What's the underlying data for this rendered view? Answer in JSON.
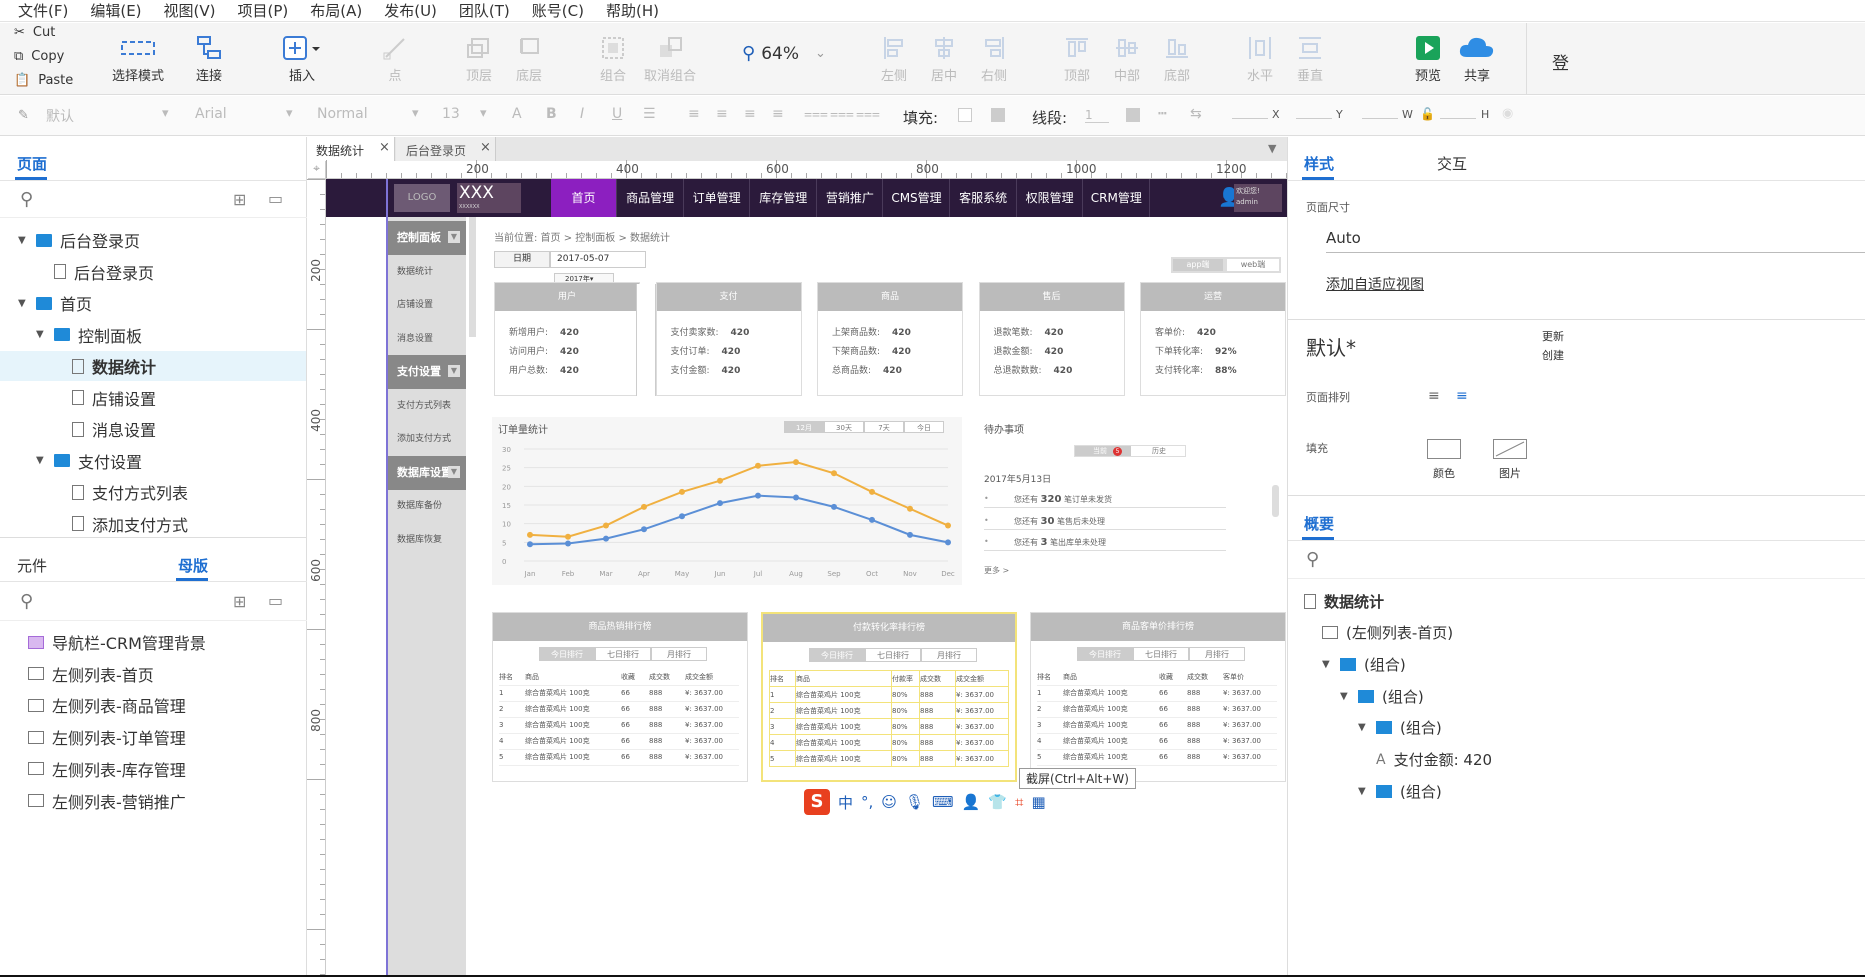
{
  "menu": [
    "文件(F)",
    "编辑(E)",
    "视图(V)",
    "项目(P)",
    "布局(A)",
    "发布(U)",
    "团队(T)",
    "账号(C)",
    "帮助(H)"
  ],
  "clipboard": {
    "cut": "Cut",
    "copy": "Copy",
    "paste": "Paste"
  },
  "toolbar": {
    "select_mode": "选择模式",
    "connect": "连接",
    "insert": "插入",
    "point": "点",
    "top_layer": "顶层",
    "bottom_layer": "底层",
    "group": "组合",
    "ungroup": "取消组合",
    "zoom": "64%",
    "align_left": "左侧",
    "align_center": "居中",
    "align_right": "右侧",
    "align_top": "顶部",
    "align_middle": "中部",
    "align_bottom": "底部",
    "dist_h": "水平",
    "dist_v": "垂直",
    "preview": "预览",
    "share": "共享",
    "login": "登"
  },
  "format": {
    "style_placeholder": "默认",
    "font": "Arial",
    "weight": "Normal",
    "size": "13",
    "fill_label": "填充:",
    "line_label": "线段:",
    "line_value": "1",
    "x": "X",
    "y": "Y",
    "w": "W",
    "h": "H"
  },
  "left": {
    "pages_tab": "页面",
    "pages": [
      {
        "label": "后台登录页",
        "level": 0,
        "type": "folder"
      },
      {
        "label": "后台登录页",
        "level": 1,
        "type": "page"
      },
      {
        "label": "首页",
        "level": 0,
        "type": "folder"
      },
      {
        "label": "控制面板",
        "level": 1,
        "type": "folder"
      },
      {
        "label": "数据统计",
        "level": 2,
        "type": "page"
      },
      {
        "label": "店铺设置",
        "level": 2,
        "type": "page"
      },
      {
        "label": "消息设置",
        "level": 2,
        "type": "page"
      },
      {
        "label": "支付设置",
        "level": 1,
        "type": "folder"
      },
      {
        "label": "支付方式列表",
        "level": 2,
        "type": "page"
      },
      {
        "label": "添加支付方式",
        "level": 2,
        "type": "page"
      }
    ],
    "widgets_tab": "元件",
    "masters_tab": "母版",
    "masters": [
      "导航栏-CRM管理背景",
      "左侧列表-首页",
      "左侧列表-商品管理",
      "左侧列表-订单管理",
      "左侧列表-库存管理",
      "左侧列表-营销推广"
    ]
  },
  "canvas": {
    "tabs": [
      "数据统计",
      "后台登录页"
    ],
    "ruler_h": [
      "200",
      "400",
      "600",
      "800",
      "1000",
      "1200"
    ],
    "ruler_v": [
      "200",
      "400",
      "600",
      "800"
    ],
    "nav": {
      "logo": "LOGO",
      "brand": "XXX",
      "brand_sub": "XXXXXX",
      "items": [
        "首页",
        "商品管理",
        "订单管理",
        "库存管理",
        "营销推广",
        "CMS管理",
        "客服系统",
        "权限管理",
        "CRM管理"
      ],
      "welcome": "欢迎您!",
      "user": "admin"
    },
    "side": [
      {
        "label": "控制面板",
        "hd": true
      },
      {
        "label": "数据统计"
      },
      {
        "label": "店铺设置"
      },
      {
        "label": "消息设置"
      },
      {
        "label": "支付设置",
        "hd": true
      },
      {
        "label": "支付方式列表"
      },
      {
        "label": "添加支付方式"
      },
      {
        "label": "数据库设置",
        "hd": true
      },
      {
        "label": "数据库备份"
      },
      {
        "label": "数据库恢复"
      }
    ],
    "breadcrumb": "当前位置:   首页  >  控制面板  >  数据统计",
    "date_label": "日期",
    "date_value": "2017-05-07",
    "date_dropdown": "2017年▾",
    "switch": [
      "app端",
      "web端"
    ],
    "cards": [
      {
        "title": "用户",
        "rows": [
          [
            "新增用户:",
            "420"
          ],
          [
            "访问用户:",
            "420"
          ],
          [
            "用户总数:",
            "420"
          ]
        ]
      },
      {
        "title": "支付",
        "rows": [
          [
            "支付卖家数:",
            "420"
          ],
          [
            "支付订单:",
            "420"
          ],
          [
            "支付金额:",
            "420"
          ]
        ]
      },
      {
        "title": "商品",
        "rows": [
          [
            "上架商品数:",
            "420"
          ],
          [
            "下架商品数:",
            "420"
          ],
          [
            "总商品数:",
            "420"
          ]
        ]
      },
      {
        "title": "售后",
        "rows": [
          [
            "退款笔数:",
            "420"
          ],
          [
            "退款金额:",
            "420"
          ],
          [
            "总退款数数:",
            "420"
          ]
        ]
      },
      {
        "title": "运营",
        "rows": [
          [
            "客单价:",
            "420"
          ],
          [
            "下单转化率:",
            "92%"
          ],
          [
            "支付转化率:",
            "88%"
          ]
        ]
      }
    ],
    "order_stats": {
      "title": "订单量统计",
      "filters": [
        "12月",
        "30天",
        "7天",
        "今日"
      ]
    },
    "todo": {
      "title": "待办事项",
      "tabs": [
        "当前",
        "历史"
      ],
      "badge": "5",
      "date": "2017年5月13日",
      "items": [
        [
          "您还有 ",
          "320",
          " 笔订单未发货"
        ],
        [
          "您还有 ",
          "30",
          " 笔售后未处理"
        ],
        [
          "您还有 ",
          "3",
          " 笔出库单未处理"
        ]
      ],
      "more": "更多  >"
    },
    "rank_tables": [
      {
        "title": "商品热销排行榜",
        "tabs": [
          "今日排行",
          "七日排行",
          "月排行"
        ],
        "headers": [
          "排名",
          "商品",
          "收藏",
          "成交数",
          "成交金额"
        ],
        "highlight": false
      },
      {
        "title": "付款转化率排行榜",
        "tabs": [
          "今日排行",
          "七日排行",
          "月排行"
        ],
        "headers": [
          "排名",
          "商品",
          "付款率",
          "成交数",
          "成交金额"
        ],
        "highlight": true
      },
      {
        "title": "商品客单价排行榜",
        "tabs": [
          "今日排行",
          "七日排行",
          "月排行"
        ],
        "headers": [
          "排名",
          "商品",
          "收藏",
          "成交数",
          "客单价"
        ],
        "highlight": false
      }
    ],
    "rank_rows": [
      [
        "1",
        "综合苗菜鸡片 100克",
        "66",
        "888",
        "¥: 3637.00"
      ],
      [
        "2",
        "综合苗菜鸡片 100克",
        "66",
        "888",
        "¥: 3637.00"
      ],
      [
        "3",
        "综合苗菜鸡片 100克",
        "66",
        "888",
        "¥: 3637.00"
      ],
      [
        "4",
        "综合苗菜鸡片 100克",
        "66",
        "888",
        "¥: 3637.00"
      ],
      [
        "5",
        "综合苗菜鸡片 100克",
        "66",
        "888",
        "¥: 3637.00"
      ]
    ],
    "rank_rows_rate": [
      [
        "1",
        "综合苗菜鸡片 100克",
        "80%",
        "888",
        "¥: 3637.00"
      ],
      [
        "2",
        "综合苗菜鸡片 100克",
        "80%",
        "888",
        "¥: 3637.00"
      ],
      [
        "3",
        "综合苗菜鸡片 100克",
        "80%",
        "888",
        "¥: 3637.00"
      ],
      [
        "4",
        "综合苗菜鸡片 100克",
        "80%",
        "888",
        "¥: 3637.00"
      ],
      [
        "5",
        "综合苗菜鸡片 100克",
        "80%",
        "888",
        "¥: 3637.00"
      ]
    ],
    "tooltip": "截屏(Ctrl+Alt+W)"
  },
  "chart_data": {
    "type": "line",
    "categories": [
      "Jan",
      "Feb",
      "Mar",
      "Apr",
      "May",
      "Jun",
      "Jul",
      "Aug",
      "Sep",
      "Oct",
      "Nov",
      "Dec"
    ],
    "series": [
      {
        "values": [
          7,
          6.5,
          9.5,
          14.5,
          18.5,
          21.5,
          25.5,
          26.5,
          23.5,
          18.5,
          14,
          9.5
        ],
        "color": "#f0b040"
      },
      {
        "values": [
          4.5,
          4.7,
          6,
          8.5,
          12,
          15.5,
          17.5,
          17,
          14.5,
          11,
          7,
          5
        ],
        "color": "#5b8fd6"
      }
    ],
    "yticks": [
      "0",
      "5",
      "10",
      "15",
      "20",
      "25",
      "30"
    ],
    "ylim": [
      0,
      30
    ]
  },
  "right": {
    "style_tab": "样式",
    "interact_tab": "交互",
    "page_size_label": "页面尺寸",
    "page_size": "Auto",
    "adaptive": "添加自适应视图",
    "default_name": "默认*",
    "update": "更新",
    "create": "创建",
    "page_align": "页面排列",
    "fill": "填充",
    "color": "颜色",
    "image": "图片",
    "outline_tab": "概要",
    "outline": [
      {
        "label": "数据统计",
        "level": 0,
        "type": "page"
      },
      {
        "label": "(左侧列表-首页)",
        "level": 1,
        "type": "master"
      },
      {
        "label": "(组合)",
        "level": 1,
        "type": "folder"
      },
      {
        "label": "(组合)",
        "level": 2,
        "type": "folder"
      },
      {
        "label": "(组合)",
        "level": 3,
        "type": "folder"
      },
      {
        "label": "支付金额:     420",
        "level": 4,
        "type": "text"
      },
      {
        "label": "(组合)",
        "level": 3,
        "type": "folder"
      }
    ]
  }
}
